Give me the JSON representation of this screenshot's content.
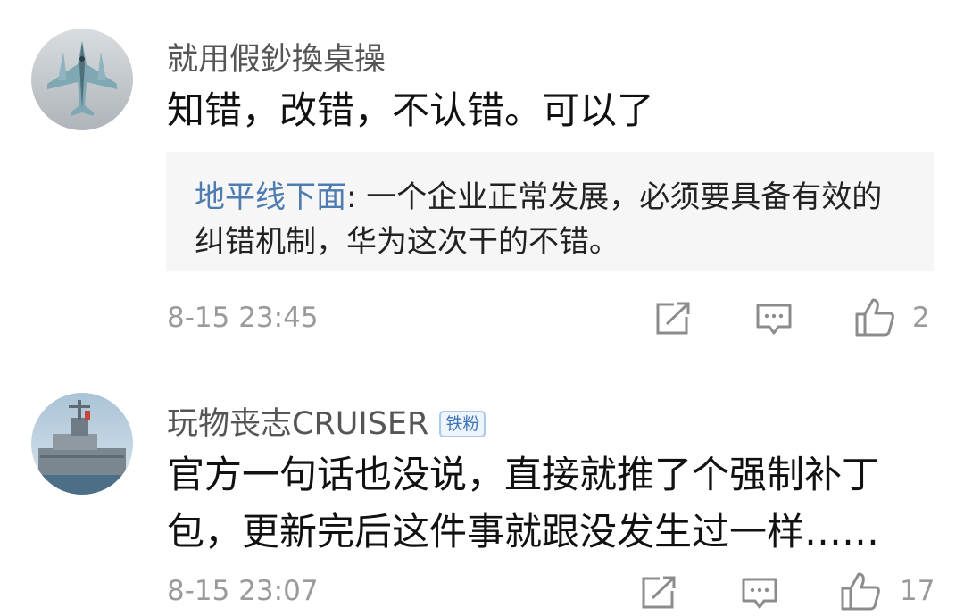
{
  "comments": [
    {
      "username": "就用假鈔換桌操",
      "text": "知错，改错，不认错。可以了",
      "quote": {
        "author": "地平线下面",
        "text": "一个企业正常发展，必须要具备有效的纠错机制，华为这次干的不错。"
      },
      "time": "8-15 23:45",
      "like_count": "2",
      "avatar_icon": "fighter-jet-icon"
    },
    {
      "username": "玩物丧志CRUISER",
      "badge": "铁粉",
      "text": "官方一句话也没说，直接就推了个强制补丁包，更新完后这件事就跟没发生过一样……",
      "time": "8-15 23:07",
      "like_count": "17",
      "avatar_icon": "warship-icon"
    }
  ],
  "colors": {
    "author_link": "#4f7cb0",
    "badge_text": "#3f76b8",
    "meta_gray": "#9a9a9a"
  }
}
